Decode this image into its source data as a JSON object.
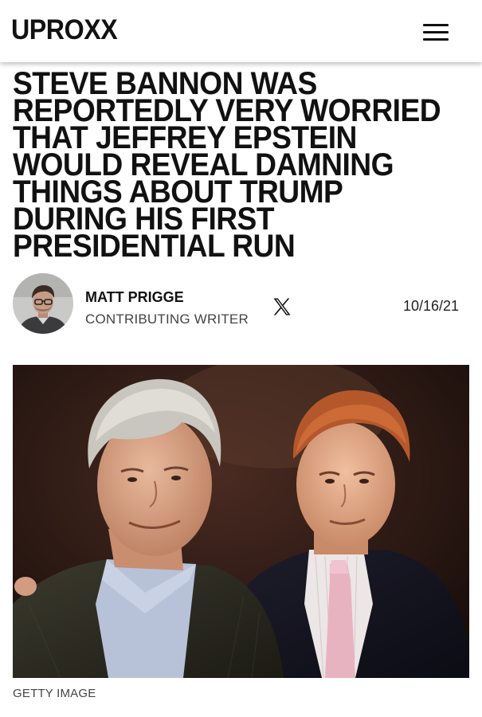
{
  "header": {
    "logo_text": "UPROXX",
    "menu_icon": "hamburger-menu-icon"
  },
  "article": {
    "headline": "STEVE BANNON WAS REPORTEDLY VERY WORRIED THAT JEFFREY EPSTEIN WOULD REVEAL DAMNING THINGS ABOUT TRUMP DURING HIS FIRST PRESIDENTIAL RUN",
    "author": {
      "name": "MATT PRIGGE",
      "role": "CONTRIBUTING WRITER",
      "social_icon": "x-logo-icon"
    },
    "date": "10/16/21",
    "image_caption": "GETTY IMAGE"
  },
  "colors": {
    "text": "#111111",
    "muted": "#444444",
    "background": "#ffffff"
  }
}
